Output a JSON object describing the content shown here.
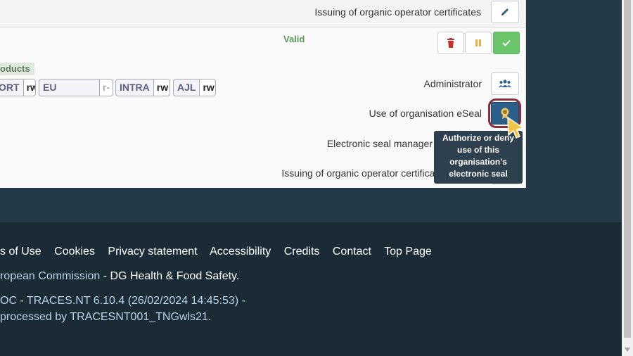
{
  "top_row": {
    "label": "Issuing of organic operator certificates"
  },
  "status": {
    "valid": "Valid"
  },
  "products_tag": "oducts",
  "permissions": [
    {
      "name": "ORT",
      "right": "rw"
    },
    {
      "name": "EU IMPORT",
      "right": "r-"
    },
    {
      "name": "INTRA",
      "right": "rw"
    },
    {
      "name": "AJL",
      "right": "rw"
    }
  ],
  "roles": {
    "administrator": "Administrator",
    "eseal": "Use of organisation eSeal",
    "eseal_manager": "Electronic seal manager",
    "organic_issuing": "Issuing of organic operator certificates"
  },
  "tooltip": {
    "lines": [
      "Authorize or deny",
      "use of this",
      "organisation's",
      "electronic seal"
    ]
  },
  "footer": {
    "links": [
      "s of Use",
      "Cookies",
      "Privacy statement",
      "Accessibility",
      "Credits",
      "Contact",
      "Top Page"
    ],
    "commission": "ropean Commission",
    "separator": " - ",
    "dg": "DG Health & Food Safety",
    "period": ".",
    "version": "OC - TRACES.NT 6.10.4 (26/02/2024 14:45:53) -",
    "processed": " processed by TRACESNT001_TNGwls21."
  },
  "colors": {
    "accent_blue": "#2c5f8a",
    "success_green": "#6ac46a",
    "danger_red": "#c9302c",
    "warning_orange": "#f0ad4e"
  }
}
